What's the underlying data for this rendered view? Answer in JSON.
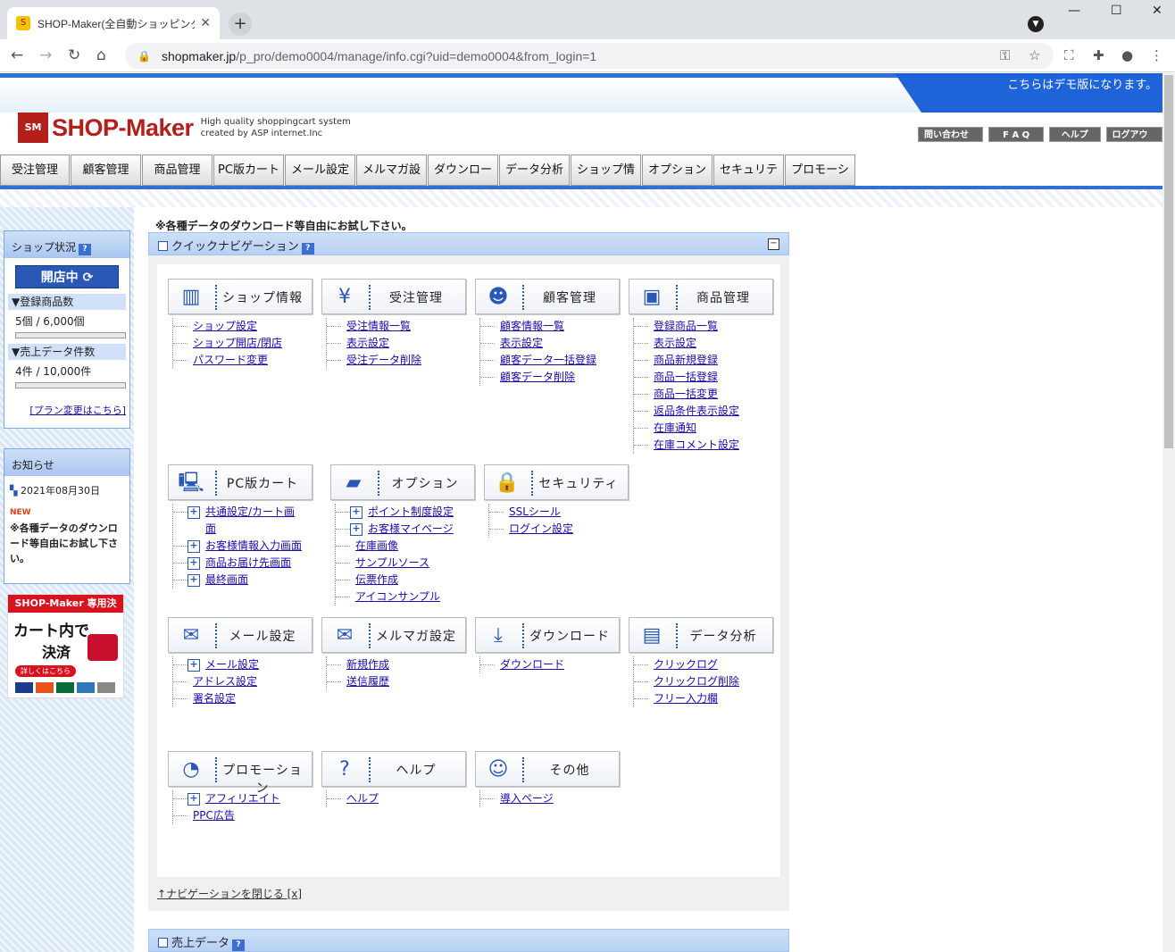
{
  "browser": {
    "tab_title": "SHOP-Maker(全自動ショッピングカー",
    "url_domain": "shopmaker.jp",
    "url_path": "/p_pro/demo0004/manage/info.cgi?uid=demo0004&from_login=1"
  },
  "header": {
    "demo_notice": "こちらはデモ版になります。",
    "logo_mark": "SM",
    "logo_text": "SHOP-Maker",
    "tagline1": "High quality shoppingcart system",
    "tagline2": "created by ASP internet.Inc",
    "links": [
      "問い合わせる",
      "F A Q",
      "ヘルプ",
      "ログアウト"
    ]
  },
  "main_nav": [
    "受注管理",
    "顧客管理",
    "商品管理",
    "PC版カート",
    "メール設定",
    "メルマガ設定",
    "ダウンロード",
    "データ分析",
    "ショップ情報",
    "オプション",
    "セキュリティ",
    "プロモーション"
  ],
  "sidebar": {
    "status_title": "ショップ状況",
    "help_badge": "?",
    "open_button": "開店中",
    "products_label": "▼登録商品数",
    "products_value": "5個 / 6,000個",
    "products_fill": 0.0008,
    "sales_label": "▼売上データ件数",
    "sales_value": "4件 / 10,000件",
    "sales_fill": 0.0004,
    "plan_link": "[プラン変更はこちら]",
    "news_title": "お知らせ",
    "news_date": "2021年08月30日",
    "news_new": "NEW",
    "news_text": "※各種データのダウンロード等自由にお試し下さい。",
    "banner_top": "SHOP-Maker 専用決済!",
    "banner_main": "カート内で",
    "banner_main2": "決済",
    "banner_btn": "詳しくはこちら"
  },
  "content": {
    "note": "※各種データのダウンロード等自由にお試し下さい。",
    "quicknav_title": "クイックナビゲーション",
    "close_nav": "↑ナビゲーションを閉じる [x]",
    "sales_title": "売上データ"
  },
  "sections": [
    {
      "label": "ショップ情報",
      "icon": "binder-icon",
      "links": [
        {
          "t": "ショップ設定"
        },
        {
          "t": "ショップ開店/閉店"
        },
        {
          "t": "パスワード変更"
        }
      ]
    },
    {
      "label": "受注管理",
      "icon": "order-icon",
      "links": [
        {
          "t": "受注情報一覧"
        },
        {
          "t": "表示設定"
        },
        {
          "t": "受注データ削除"
        }
      ]
    },
    {
      "label": "顧客管理",
      "icon": "customer-icon",
      "links": [
        {
          "t": "顧客情報一覧"
        },
        {
          "t": "表示設定"
        },
        {
          "t": "顧客データ一括登録"
        },
        {
          "t": "顧客データ削除"
        }
      ]
    },
    {
      "label": "商品管理",
      "icon": "box-icon",
      "links": [
        {
          "t": "登録商品一覧"
        },
        {
          "t": "表示設定"
        },
        {
          "t": "商品新規登録"
        },
        {
          "t": "商品一括登録"
        },
        {
          "t": "商品一括変更"
        },
        {
          "t": "返品条件表示設定"
        },
        {
          "t": "在庫通知"
        },
        {
          "t": "在庫コメント設定"
        }
      ]
    },
    {
      "label": "PC版カート",
      "icon": "pc-cart-icon",
      "links": [
        {
          "t": "共通設定/カート画",
          "plus": true
        },
        {
          "t": "面",
          "cont": true
        },
        {
          "t": "お客様情報入力画面",
          "plus": true
        },
        {
          "t": "商品お届け先画面",
          "plus": true
        },
        {
          "t": "最終画面",
          "plus": true
        }
      ]
    },
    {
      "label": "オプション",
      "icon": "folder-icon",
      "links": [
        {
          "t": "ポイント制度設定",
          "plus": true
        },
        {
          "t": "お客様マイページ",
          "plus": true
        },
        {
          "t": "在庫画像"
        },
        {
          "t": "サンプルソース"
        },
        {
          "t": "伝票作成"
        },
        {
          "t": "アイコンサンプル"
        }
      ]
    },
    {
      "label": "セキュリティ",
      "icon": "lock-icon",
      "links": [
        {
          "t": "SSLシール"
        },
        {
          "t": "ログイン設定"
        }
      ]
    },
    {
      "label": "メール設定",
      "icon": "mail-tool-icon",
      "links": [
        {
          "t": "メール設定",
          "plus": true
        },
        {
          "t": "アドレス設定"
        },
        {
          "t": "署名設定"
        }
      ]
    },
    {
      "label": "メルマガ設定",
      "icon": "newsletter-icon",
      "links": [
        {
          "t": "新規作成"
        },
        {
          "t": "送信履歴"
        }
      ]
    },
    {
      "label": "ダウンロード",
      "icon": "download-icon",
      "links": [
        {
          "t": "ダウンロード"
        }
      ]
    },
    {
      "label": "データ分析",
      "icon": "chart-icon",
      "links": [
        {
          "t": "クリックログ"
        },
        {
          "t": "クリックログ削除"
        },
        {
          "t": "フリー入力欄"
        }
      ]
    },
    {
      "label": "プロモーション",
      "icon": "promotion-icon",
      "links": [
        {
          "t": "アフィリエイト",
          "plus": true
        },
        {
          "t": "PPC広告"
        }
      ]
    },
    {
      "label": "ヘルプ",
      "icon": "help-icon",
      "links": [
        {
          "t": "ヘルプ"
        }
      ]
    },
    {
      "label": "その他",
      "icon": "other-icon",
      "links": [
        {
          "t": "導入ページ"
        }
      ]
    }
  ]
}
